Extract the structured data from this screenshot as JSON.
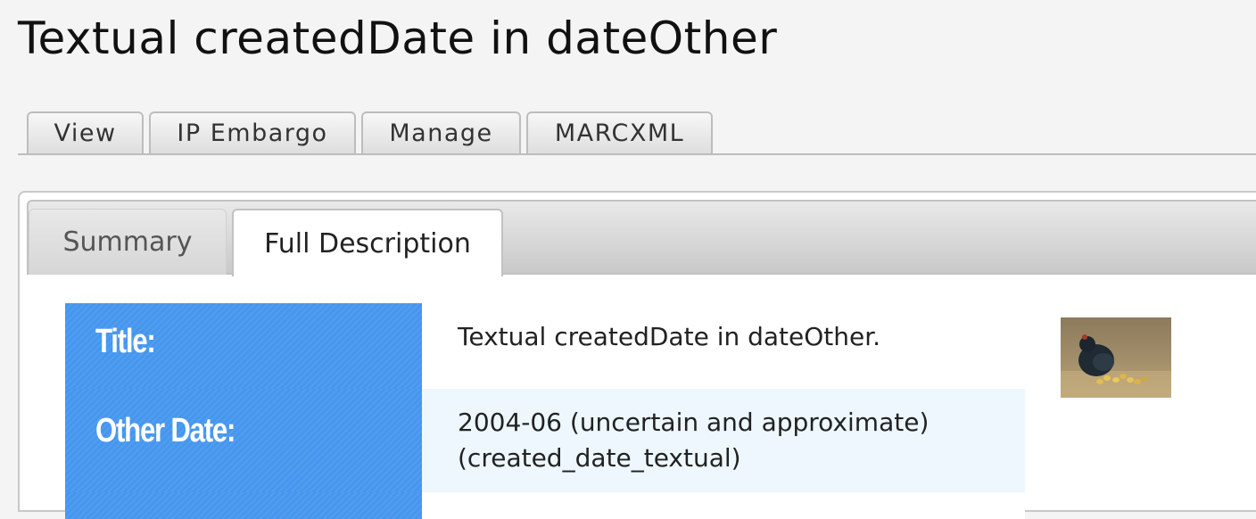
{
  "page": {
    "title": "Textual createdDate in dateOther"
  },
  "primary_tabs": [
    {
      "label": "View"
    },
    {
      "label": "IP Embargo"
    },
    {
      "label": "Manage"
    },
    {
      "label": "MARCXML"
    }
  ],
  "sub_tabs": [
    {
      "label": "Summary",
      "active": false
    },
    {
      "label": "Full Description",
      "active": true
    }
  ],
  "metadata": {
    "title_label": "Title:",
    "title_value": "Textual createdDate in dateOther.",
    "other_date_label": "Other Date:",
    "other_date_value_line1": "2004-06 (uncertain and approximate)",
    "other_date_value_line2": "(created_date_textual)"
  },
  "thumbnail": {
    "icon": "hen-with-chicks-painting-thumbnail"
  },
  "colors": {
    "label_bg": "#4596ee",
    "alt_row_bg": "#edf7fd",
    "page_bg": "#f4f4f4"
  }
}
